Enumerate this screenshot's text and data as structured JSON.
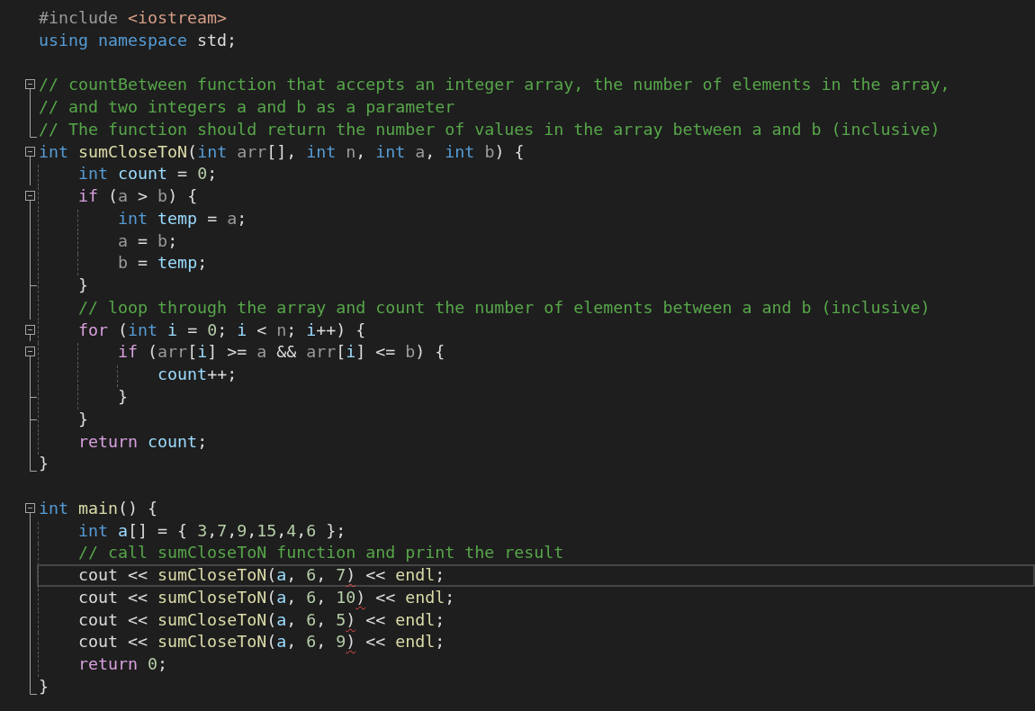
{
  "editor": {
    "lines": [
      {
        "kind": "plain",
        "selected": false,
        "tokens": [
          {
            "kind": "pp",
            "text": "#include "
          },
          {
            "kind": "str",
            "text": "<iostream>"
          }
        ]
      },
      {
        "kind": "plain",
        "selected": false,
        "tokens": [
          {
            "kind": "kw",
            "text": "using"
          },
          {
            "kind": "kw",
            "text": " namespace"
          },
          {
            "kind": "p",
            "text": " std;"
          }
        ]
      },
      {
        "kind": "plain",
        "selected": false
      },
      {
        "kind": "start",
        "selected": false,
        "tokens": [
          {
            "kind": "cmt",
            "text": "// countBetween function that accepts an integer array, the number of elements in the array,"
          }
        ]
      },
      {
        "kind": "body",
        "selected": false,
        "tokens": [
          {
            "kind": "cmt",
            "text": "// and two integers a and b as a parameter"
          }
        ]
      },
      {
        "kind": "end",
        "selected": false,
        "tokens": [
          {
            "kind": "cmt",
            "text": "// The function should return the number of values in the array between a and b (inclusive)"
          }
        ]
      },
      {
        "kind": "start",
        "selected": false,
        "tokens": [
          {
            "kind": "kw",
            "text": "int"
          },
          {
            "kind": "fn",
            "text": " sumCloseToN"
          },
          {
            "kind": "p",
            "text": "("
          },
          {
            "kind": "kw",
            "text": "int"
          },
          {
            "kind": "param",
            "text": " arr"
          },
          {
            "kind": "p",
            "text": "[], "
          },
          {
            "kind": "kw",
            "text": "int"
          },
          {
            "kind": "param",
            "text": " n"
          },
          {
            "kind": "p",
            "text": ", "
          },
          {
            "kind": "kw",
            "text": "int"
          },
          {
            "kind": "param",
            "text": " a"
          },
          {
            "kind": "p",
            "text": ", "
          },
          {
            "kind": "kw",
            "text": "int"
          },
          {
            "kind": "param",
            "text": " b"
          },
          {
            "kind": "p",
            "text": ") {"
          }
        ]
      },
      {
        "kind": "body",
        "selected": false,
        "tokens": [
          {
            "kind": "kw",
            "text": "    int"
          },
          {
            "kind": "var",
            "text": " count"
          },
          {
            "kind": "p",
            "text": " = "
          },
          {
            "kind": "num",
            "text": "0"
          },
          {
            "kind": "p",
            "text": ";"
          }
        ]
      },
      {
        "kind": "start",
        "selected": false,
        "tokens": [
          {
            "kind": "ctl",
            "text": "    if"
          },
          {
            "kind": "p",
            "text": " ("
          },
          {
            "kind": "param",
            "text": "a"
          },
          {
            "kind": "p",
            "text": " > "
          },
          {
            "kind": "param",
            "text": "b"
          },
          {
            "kind": "p",
            "text": ") {"
          }
        ]
      },
      {
        "kind": "body",
        "selected": false,
        "tokens": [
          {
            "kind": "kw",
            "text": "        int"
          },
          {
            "kind": "var",
            "text": " temp"
          },
          {
            "kind": "p",
            "text": " = "
          },
          {
            "kind": "param",
            "text": "a"
          },
          {
            "kind": "p",
            "text": ";"
          }
        ]
      },
      {
        "kind": "body",
        "selected": false,
        "tokens": [
          {
            "kind": "param",
            "text": "        a"
          },
          {
            "kind": "p",
            "text": " = "
          },
          {
            "kind": "param",
            "text": "b"
          },
          {
            "kind": "p",
            "text": ";"
          }
        ]
      },
      {
        "kind": "body",
        "selected": false,
        "tokens": [
          {
            "kind": "param",
            "text": "        b"
          },
          {
            "kind": "p",
            "text": " = "
          },
          {
            "kind": "var",
            "text": "temp"
          },
          {
            "kind": "p",
            "text": ";"
          }
        ]
      },
      {
        "kind": "tick",
        "selected": false,
        "tokens": [
          {
            "kind": "p",
            "text": "    }"
          }
        ]
      },
      {
        "kind": "body",
        "selected": false,
        "tokens": [
          {
            "kind": "cmt",
            "text": "    // loop through the array and count the number of elements between a and b (inclusive)"
          }
        ]
      },
      {
        "kind": "start",
        "selected": false,
        "tokens": [
          {
            "kind": "ctl",
            "text": "    for"
          },
          {
            "kind": "p",
            "text": " ("
          },
          {
            "kind": "kw",
            "text": "int"
          },
          {
            "kind": "var",
            "text": " i"
          },
          {
            "kind": "p",
            "text": " = "
          },
          {
            "kind": "num",
            "text": "0"
          },
          {
            "kind": "p",
            "text": "; "
          },
          {
            "kind": "var",
            "text": "i"
          },
          {
            "kind": "p",
            "text": " < "
          },
          {
            "kind": "param",
            "text": "n"
          },
          {
            "kind": "p",
            "text": "; "
          },
          {
            "kind": "var",
            "text": "i"
          },
          {
            "kind": "p",
            "text": "++) {"
          }
        ]
      },
      {
        "kind": "start",
        "selected": false,
        "tokens": [
          {
            "kind": "ctl",
            "text": "        if"
          },
          {
            "kind": "p",
            "text": " ("
          },
          {
            "kind": "param",
            "text": "arr"
          },
          {
            "kind": "p",
            "text": "["
          },
          {
            "kind": "var",
            "text": "i"
          },
          {
            "kind": "p",
            "text": "] >= "
          },
          {
            "kind": "param",
            "text": "a"
          },
          {
            "kind": "p",
            "text": " && "
          },
          {
            "kind": "param",
            "text": "arr"
          },
          {
            "kind": "p",
            "text": "["
          },
          {
            "kind": "var",
            "text": "i"
          },
          {
            "kind": "p",
            "text": "] <= "
          },
          {
            "kind": "param",
            "text": "b"
          },
          {
            "kind": "p",
            "text": ") {"
          }
        ]
      },
      {
        "kind": "body",
        "selected": false,
        "tokens": [
          {
            "kind": "var",
            "text": "            count"
          },
          {
            "kind": "p",
            "text": "++;"
          }
        ]
      },
      {
        "kind": "tick",
        "selected": false,
        "tokens": [
          {
            "kind": "p",
            "text": "        }"
          }
        ]
      },
      {
        "kind": "tick",
        "selected": false,
        "tokens": [
          {
            "kind": "p",
            "text": "    }"
          }
        ]
      },
      {
        "kind": "body",
        "selected": false,
        "tokens": [
          {
            "kind": "ctl",
            "text": "    return"
          },
          {
            "kind": "var",
            "text": " count"
          },
          {
            "kind": "p",
            "text": ";"
          }
        ]
      },
      {
        "kind": "end",
        "selected": false,
        "tokens": [
          {
            "kind": "p",
            "text": "}"
          }
        ]
      },
      {
        "kind": "plain",
        "selected": false
      },
      {
        "kind": "start",
        "selected": false,
        "tokens": [
          {
            "kind": "kw",
            "text": "int"
          },
          {
            "kind": "fn",
            "text": " main"
          },
          {
            "kind": "p",
            "text": "() {"
          }
        ]
      },
      {
        "kind": "body",
        "selected": false,
        "tokens": [
          {
            "kind": "kw",
            "text": "    int"
          },
          {
            "kind": "var",
            "text": " a"
          },
          {
            "kind": "p",
            "text": "[] = { "
          },
          {
            "kind": "num",
            "text": "3"
          },
          {
            "kind": "p",
            "text": ","
          },
          {
            "kind": "num",
            "text": "7"
          },
          {
            "kind": "p",
            "text": ","
          },
          {
            "kind": "num",
            "text": "9"
          },
          {
            "kind": "p",
            "text": ","
          },
          {
            "kind": "num",
            "text": "15"
          },
          {
            "kind": "p",
            "text": ","
          },
          {
            "kind": "num",
            "text": "4"
          },
          {
            "kind": "p",
            "text": ","
          },
          {
            "kind": "num",
            "text": "6"
          },
          {
            "kind": "p",
            "text": " };"
          }
        ]
      },
      {
        "kind": "body",
        "selected": false,
        "tokens": [
          {
            "kind": "cmt",
            "text": "    // call sumCloseToN function and print the result"
          }
        ]
      },
      {
        "kind": "body",
        "selected": true,
        "tokens": [
          {
            "kind": "p",
            "text": "    cout << "
          },
          {
            "kind": "fn",
            "text": "sumCloseToN"
          },
          {
            "kind": "p",
            "text": "("
          },
          {
            "kind": "var",
            "text": "a"
          },
          {
            "kind": "p",
            "text": ", "
          },
          {
            "kind": "num",
            "text": "6"
          },
          {
            "kind": "p",
            "text": ", "
          },
          {
            "kind": "num",
            "text": "7"
          },
          {
            "kind": "p",
            "text": ")",
            "squiggle": true
          },
          {
            "kind": "p",
            "text": " << "
          },
          {
            "kind": "fn",
            "text": "endl"
          },
          {
            "kind": "p",
            "text": ";"
          }
        ]
      },
      {
        "kind": "body",
        "selected": false,
        "tokens": [
          {
            "kind": "p",
            "text": "    cout << "
          },
          {
            "kind": "fn",
            "text": "sumCloseToN"
          },
          {
            "kind": "p",
            "text": "("
          },
          {
            "kind": "var",
            "text": "a"
          },
          {
            "kind": "p",
            "text": ", "
          },
          {
            "kind": "num",
            "text": "6"
          },
          {
            "kind": "p",
            "text": ", "
          },
          {
            "kind": "num",
            "text": "10"
          },
          {
            "kind": "p",
            "text": ")",
            "squiggle": true
          },
          {
            "kind": "p",
            "text": " << "
          },
          {
            "kind": "fn",
            "text": "endl"
          },
          {
            "kind": "p",
            "text": ";"
          }
        ]
      },
      {
        "kind": "body",
        "selected": false,
        "tokens": [
          {
            "kind": "p",
            "text": "    cout << "
          },
          {
            "kind": "fn",
            "text": "sumCloseToN"
          },
          {
            "kind": "p",
            "text": "("
          },
          {
            "kind": "var",
            "text": "a"
          },
          {
            "kind": "p",
            "text": ", "
          },
          {
            "kind": "num",
            "text": "6"
          },
          {
            "kind": "p",
            "text": ", "
          },
          {
            "kind": "num",
            "text": "5"
          },
          {
            "kind": "p",
            "text": ")",
            "squiggle": true
          },
          {
            "kind": "p",
            "text": " << "
          },
          {
            "kind": "fn",
            "text": "endl"
          },
          {
            "kind": "p",
            "text": ";"
          }
        ]
      },
      {
        "kind": "body",
        "selected": false,
        "tokens": [
          {
            "kind": "p",
            "text": "    cout << "
          },
          {
            "kind": "fn",
            "text": "sumCloseToN"
          },
          {
            "kind": "p",
            "text": "("
          },
          {
            "kind": "var",
            "text": "a"
          },
          {
            "kind": "p",
            "text": ", "
          },
          {
            "kind": "num",
            "text": "6"
          },
          {
            "kind": "p",
            "text": ", "
          },
          {
            "kind": "num",
            "text": "9"
          },
          {
            "kind": "p",
            "text": ")",
            "squiggle": true
          },
          {
            "kind": "p",
            "text": " << "
          },
          {
            "kind": "fn",
            "text": "endl"
          },
          {
            "kind": "p",
            "text": ";"
          }
        ]
      },
      {
        "kind": "body",
        "selected": false,
        "tokens": [
          {
            "kind": "ctl",
            "text": "    return"
          },
          {
            "kind": "num",
            "text": " 0"
          },
          {
            "kind": "p",
            "text": ";"
          }
        ]
      },
      {
        "kind": "end",
        "selected": false,
        "tokens": [
          {
            "kind": "p",
            "text": "}"
          }
        ]
      }
    ]
  }
}
